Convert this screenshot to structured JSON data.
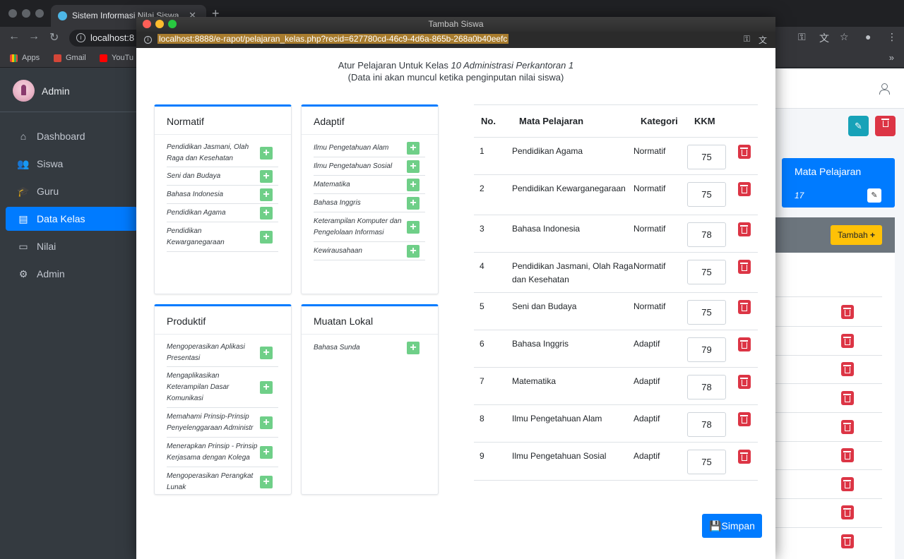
{
  "browser": {
    "tab_title": "Sistem Informasi Nilai Siswa",
    "url": "localhost:8",
    "bookmarks": [
      "Apps",
      "Gmail",
      "YouTu"
    ]
  },
  "sidebar": {
    "user": "Admin",
    "items": [
      {
        "label": "Dashboard",
        "icon": "home-icon",
        "glyph": "⌂"
      },
      {
        "label": "Siswa",
        "icon": "users-icon",
        "glyph": "👥"
      },
      {
        "label": "Guru",
        "icon": "teacher-icon",
        "glyph": "🎓"
      },
      {
        "label": "Data Kelas",
        "icon": "class-icon",
        "glyph": "▤"
      },
      {
        "label": "Nilai",
        "icon": "folder-icon",
        "glyph": "▭"
      },
      {
        "label": "Admin",
        "icon": "gear-icon",
        "glyph": "⚙"
      }
    ]
  },
  "background": {
    "card_title": "Mata Pelajaran",
    "card_count": "17",
    "add_button": "Tambah"
  },
  "modal": {
    "window_title": "Tambah Siswa",
    "url": "localhost:8888/e-rapot/pelajaran_kelas.php?recid=627780cd-46c9-4d6a-865b-268a0b40eefc",
    "heading_prefix": "Atur Pelajaran Untuk Kelas",
    "class_name": "10 Administrasi Perkantoran 1",
    "subheading": "(Data ini akan muncul ketika penginputan nilai siswa)",
    "save_label": "Simpan",
    "groups": [
      {
        "title": "Normatif",
        "items": [
          "Pendidikan Jasmani, Olah Raga dan Kesehatan",
          "Seni dan Budaya",
          "Bahasa Indonesia",
          "Pendidikan Agama",
          "Pendidikan Kewarganegaraan"
        ]
      },
      {
        "title": "Adaptif",
        "items": [
          "Ilmu Pengetahuan Alam",
          "Ilmu Pengetahuan Sosial",
          "Matematika",
          "Bahasa Inggris",
          "Keterampilan Komputer dan Pengelolaan Informasi",
          "Kewirausahaan"
        ]
      },
      {
        "title": "Produktif",
        "items": [
          "Mengoperasikan Aplikasi Presentasi",
          "Mengaplikasikan Keterampilan Dasar Komunikasi",
          "Memahami Prinsip-Prinsip Penyelenggaraan Administr",
          "Menerapkan Prinsip - Prinsip Kerjasama dengan Kolega",
          "Mengoperasikan Perangkat Lunak"
        ]
      },
      {
        "title": "Muatan Lokal",
        "items": [
          "Bahasa Sunda"
        ]
      }
    ],
    "table": {
      "headers": [
        "No.",
        "Mata Pelajaran",
        "Kategori",
        "KKM"
      ],
      "rows": [
        {
          "no": "1",
          "subject": "Pendidikan Agama",
          "category": "Normatif",
          "kkm": "75"
        },
        {
          "no": "2",
          "subject": "Pendidikan Kewarganegaraan",
          "category": "Normatif",
          "kkm": "75"
        },
        {
          "no": "3",
          "subject": "Bahasa Indonesia",
          "category": "Normatif",
          "kkm": "78"
        },
        {
          "no": "4",
          "subject": "Pendidikan Jasmani, Olah Raga dan Kesehatan",
          "category": "Normatif",
          "kkm": "75"
        },
        {
          "no": "5",
          "subject": "Seni dan Budaya",
          "category": "Normatif",
          "kkm": "75"
        },
        {
          "no": "6",
          "subject": "Bahasa Inggris",
          "category": "Adaptif",
          "kkm": "79"
        },
        {
          "no": "7",
          "subject": "Matematika",
          "category": "Adaptif",
          "kkm": "78"
        },
        {
          "no": "8",
          "subject": "Ilmu Pengetahuan Alam",
          "category": "Adaptif",
          "kkm": "78"
        },
        {
          "no": "9",
          "subject": "Ilmu Pengetahuan Sosial",
          "category": "Adaptif",
          "kkm": "75"
        }
      ]
    }
  }
}
